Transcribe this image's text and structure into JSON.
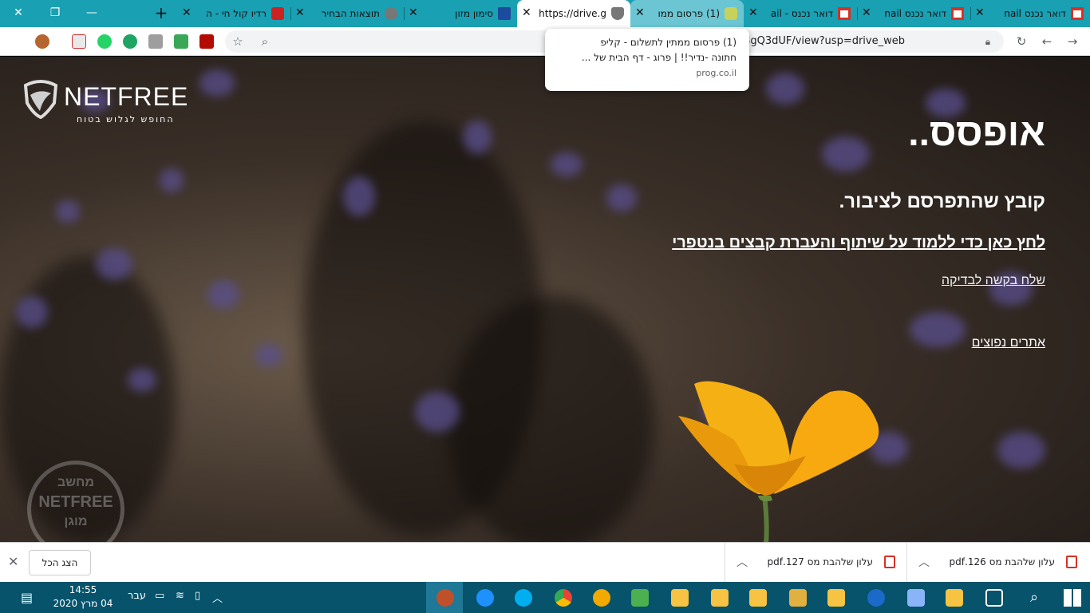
{
  "tabs": [
    {
      "title": "דואר נכנס nail",
      "favicon": "gmail-icon"
    },
    {
      "title": "דואר נכנס nail",
      "favicon": "gmail-icon"
    },
    {
      "title": "דואר נכנס - ail",
      "favicon": "gmail-icon"
    },
    {
      "title": "(1) פרסום ממו",
      "favicon": "leaf-icon"
    },
    {
      "title": "https://drive.g",
      "favicon": "shield-icon"
    },
    {
      "title": "סימון מזון",
      "favicon": "emblem-icon"
    },
    {
      "title": "תוצאות הבחיר",
      "favicon": "globe-icon"
    },
    {
      "title": "רדיו קול חי - ה",
      "favicon": "radio-icon"
    }
  ],
  "toolbar": {
    "url": "k1E5OTCCtdj9S8gQ3dUF/view?usp=drive_web"
  },
  "tooltip": {
    "line1": "(1) פרסום ממתין לתשלום - קליפ",
    "line2": "חתונה -נדיר!! | פרוג - דף הבית של ...",
    "domain": "prog.co.il"
  },
  "page": {
    "logo_word": "NETFREE",
    "logo_tagline": "החופש לגלוש בטוח",
    "heading": "אופסס..",
    "subheading": "קובץ שהתפרסם לציבור.",
    "learn_link": "לחץ כאן כדי ללמוד על שיתוף והעברת קבצים בנטפרי",
    "request_link": "שלח בקשה לבדיקה",
    "popular_link": "אתרים נפוצים",
    "stamp_top": "מחשב",
    "stamp_mid": "NETFREE",
    "stamp_bottom": "מוגן"
  },
  "downloads": {
    "items": [
      {
        "name": "עלון שלהבת מס 126.pdf"
      },
      {
        "name": "עלון שלהבת מס 127.pdf"
      }
    ],
    "show_all": "הצג הכל"
  },
  "taskbar": {
    "time": "14:55",
    "date": "04 מרץ 2020",
    "lang": "עבר"
  },
  "colors": {
    "tabbar": "#1aa0b3",
    "taskbar": "#06536b",
    "flower": "#f5b014"
  }
}
